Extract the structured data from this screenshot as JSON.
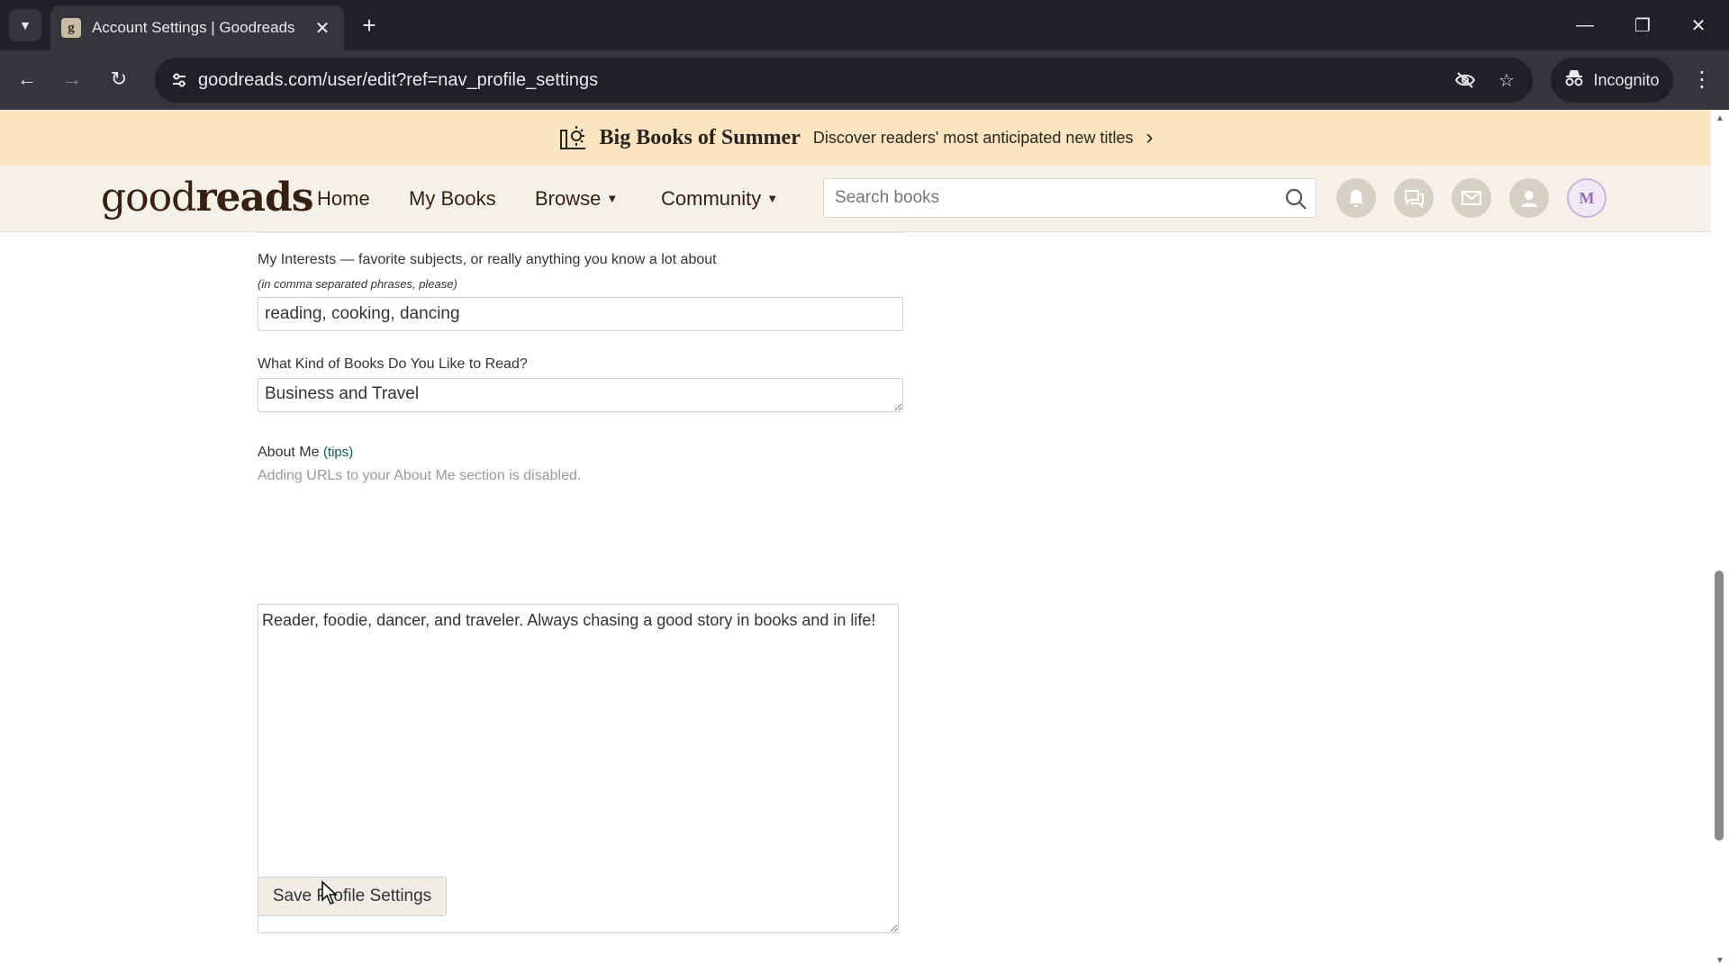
{
  "browser": {
    "tab_title": "Account Settings | Goodreads",
    "favicon_letter": "g",
    "url": "goodreads.com/user/edit?ref=nav_profile_settings",
    "incognito_label": "Incognito"
  },
  "promo": {
    "title": "Big Books of Summer",
    "subtitle": "Discover readers' most anticipated new titles"
  },
  "header": {
    "logo_light": "good",
    "logo_bold": "reads",
    "nav": {
      "home": "Home",
      "my_books": "My Books",
      "browse": "Browse",
      "community": "Community"
    },
    "search_placeholder": "Search books",
    "avatar_initial": "M"
  },
  "form": {
    "interests_label": "My Interests — favorite subjects, or really anything you know a lot about",
    "interests_hint": "(in comma separated phrases, please)",
    "interests_value": "reading, cooking, dancing",
    "books_label": "What Kind of Books Do You Like to Read?",
    "books_value": "Business and Travel",
    "about_label": "About Me",
    "about_tips": "(tips)",
    "about_note": "Adding URLs to your About Me section is disabled.",
    "about_value": "Reader, foodie, dancer, and traveler. Always chasing a good story in books and in life!",
    "save_label": "Save Profile Settings"
  },
  "colors": {
    "promo_bg": "#fbe4c0",
    "header_bg": "#f4f1ea",
    "brand": "#382110",
    "link": "#00635d"
  }
}
